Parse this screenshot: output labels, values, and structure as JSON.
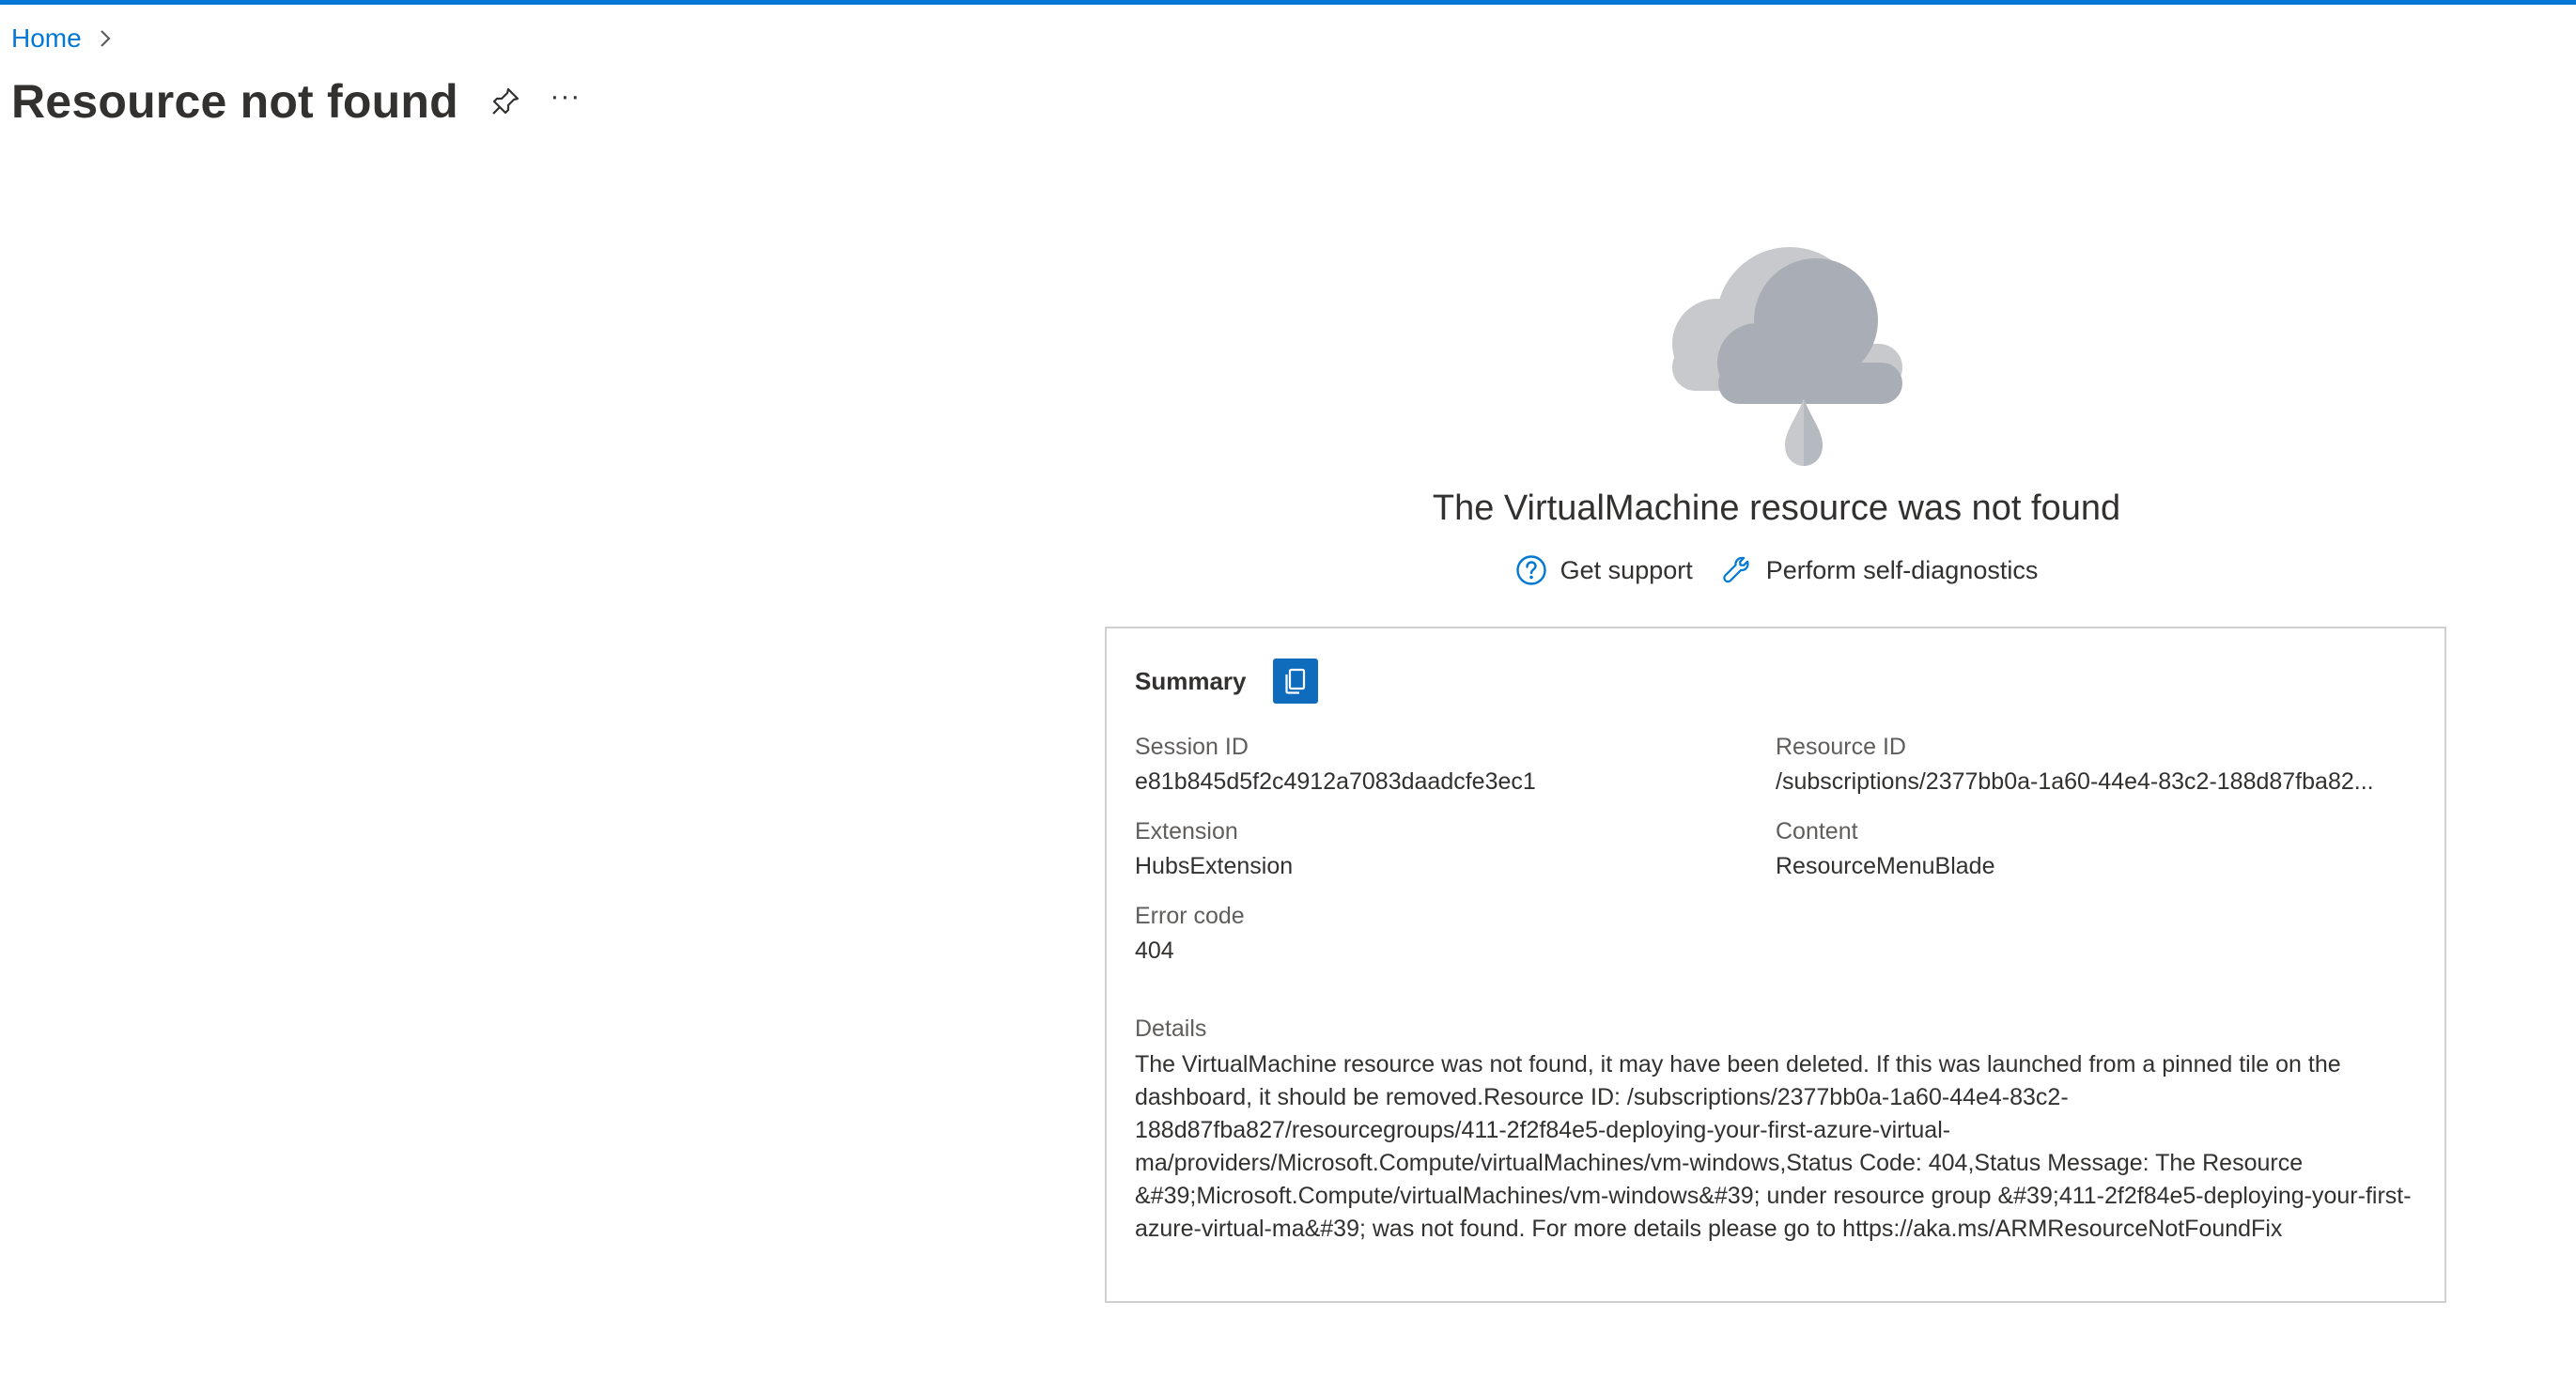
{
  "breadcrumb": {
    "home_label": "Home"
  },
  "header": {
    "title": "Resource not found",
    "pin_icon": "pin-icon",
    "more_label": "···"
  },
  "error": {
    "illustration": "cloud-rain-icon",
    "heading": "The VirtualMachine resource was not found",
    "links": {
      "support_label": "Get support",
      "diagnostics_label": "Perform self-diagnostics"
    }
  },
  "summary": {
    "title": "Summary",
    "copy_icon": "copy-icon",
    "session_id": {
      "label": "Session ID",
      "value": "e81b845d5f2c4912a7083daadcfe3ec1"
    },
    "resource_id": {
      "label": "Resource ID",
      "value": "/subscriptions/2377bb0a-1a60-44e4-83c2-188d87fba82..."
    },
    "extension": {
      "label": "Extension",
      "value": "HubsExtension"
    },
    "content": {
      "label": "Content",
      "value": "ResourceMenuBlade"
    },
    "error_code": {
      "label": "Error code",
      "value": "404"
    },
    "details": {
      "label": "Details",
      "value": "The VirtualMachine resource was not found, it may have been deleted. If this was launched from a pinned tile on the dashboard, it should be removed.Resource ID: /subscriptions/2377bb0a-1a60-44e4-83c2-188d87fba827/resourcegroups/411-2f2f84e5-deploying-your-first-azure-virtual-ma/providers/Microsoft.Compute/virtualMachines/vm-windows,Status Code: 404,Status Message: The Resource &#39;Microsoft.Compute/virtualMachines/vm-windows&#39; under resource group &#39;411-2f2f84e5-deploying-your-first-azure-virtual-ma&#39; was not found. For more details please go to https://aka.ms/ARMResourceNotFoundFix"
    }
  },
  "colors": {
    "accent": "#0078d4",
    "copy_button": "#0f6cbd",
    "cloud_light": "#c8c6c4",
    "cloud_dark": "#a6a9b0"
  }
}
